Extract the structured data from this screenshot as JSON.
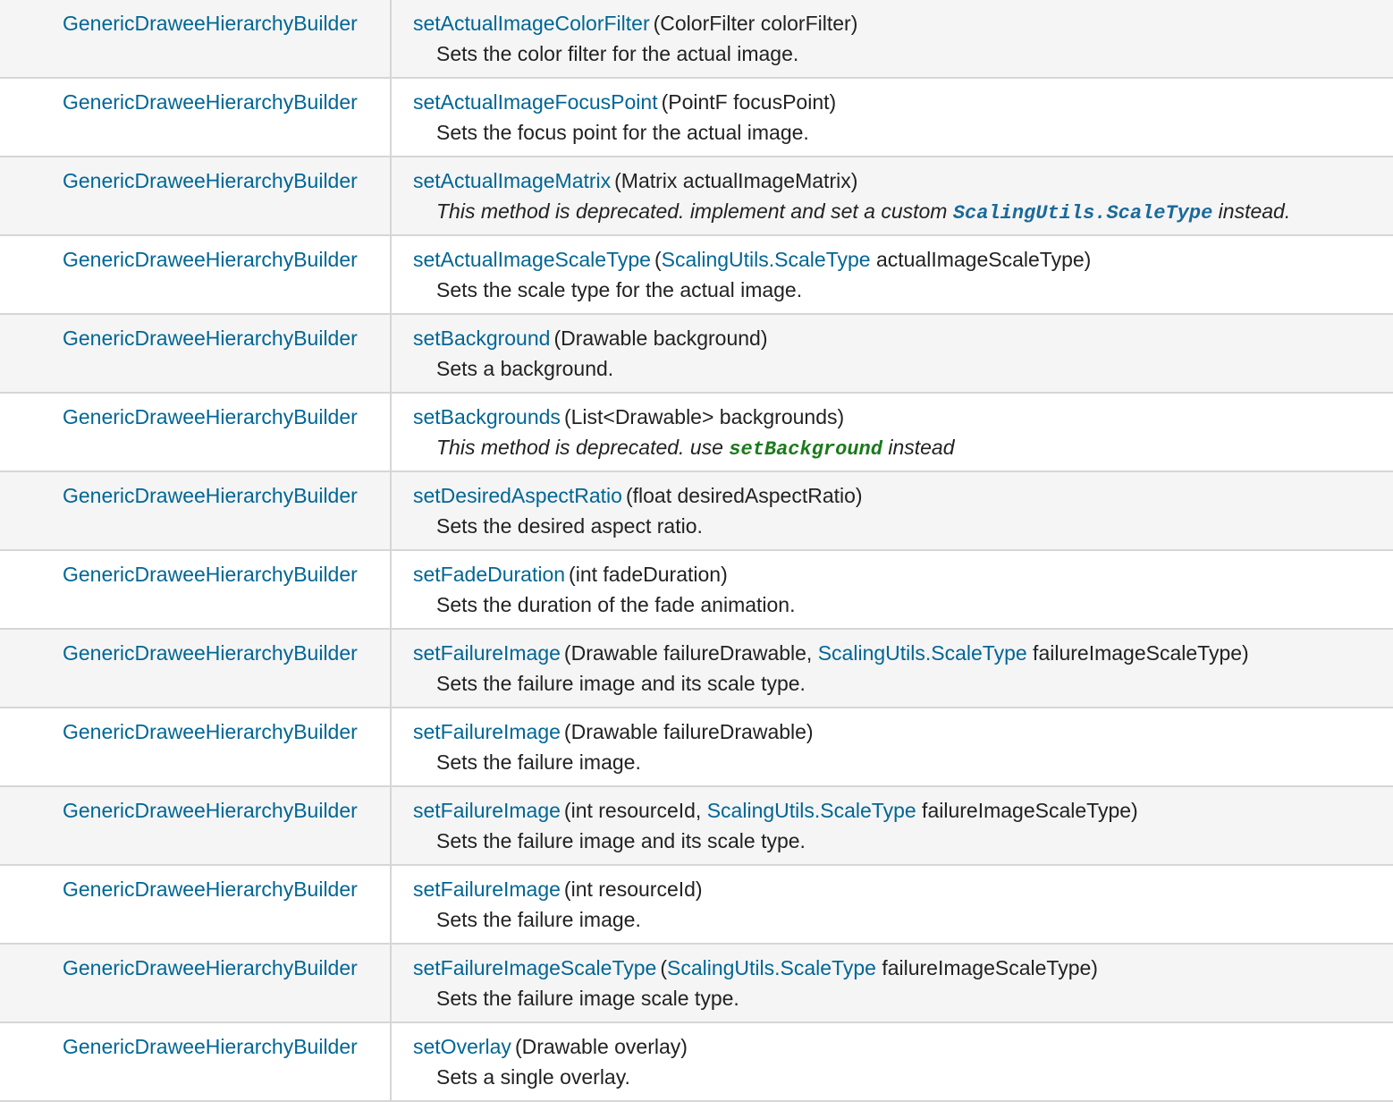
{
  "colors": {
    "link": "#006695",
    "row_shade": "#f5f5f5",
    "row_plain": "#ffffff",
    "border": "#d6d6d6",
    "code_blue": "#1a6a9a",
    "code_green": "#1b7a1b"
  },
  "rows": [
    {
      "return_type": "GenericDraweeHierarchyBuilder",
      "method": "setActualImageColorFilter",
      "params": [
        {
          "text": "(ColorFilter colorFilter)",
          "link": false
        }
      ],
      "description": "Sets the color filter for the actual image.",
      "deprecated": false
    },
    {
      "return_type": "GenericDraweeHierarchyBuilder",
      "method": "setActualImageFocusPoint",
      "params": [
        {
          "text": "(PointF focusPoint)",
          "link": false
        }
      ],
      "description": "Sets the focus point for the actual image.",
      "deprecated": false
    },
    {
      "return_type": "GenericDraweeHierarchyBuilder",
      "method": "setActualImageMatrix",
      "params": [
        {
          "text": "(Matrix actualImageMatrix)",
          "link": false
        }
      ],
      "description_parts": [
        {
          "text": "This method is deprecated. implement and set a custom ",
          "kind": "plain"
        },
        {
          "text": "ScalingUtils.ScaleType",
          "kind": "code-blue"
        },
        {
          "text": " instead.",
          "kind": "plain"
        }
      ],
      "deprecated": true
    },
    {
      "return_type": "GenericDraweeHierarchyBuilder",
      "method": "setActualImageScaleType",
      "params": [
        {
          "text": "(",
          "link": false
        },
        {
          "text": "ScalingUtils.ScaleType",
          "link": true
        },
        {
          "text": " actualImageScaleType)",
          "link": false
        }
      ],
      "description": "Sets the scale type for the actual image.",
      "deprecated": false
    },
    {
      "return_type": "GenericDraweeHierarchyBuilder",
      "method": "setBackground",
      "params": [
        {
          "text": "(Drawable background)",
          "link": false
        }
      ],
      "description": "Sets a background.",
      "deprecated": false
    },
    {
      "return_type": "GenericDraweeHierarchyBuilder",
      "method": "setBackgrounds",
      "params": [
        {
          "text": "(List<Drawable> backgrounds)",
          "link": false
        }
      ],
      "description_parts": [
        {
          "text": "This method is deprecated. use ",
          "kind": "plain"
        },
        {
          "text": "setBackground",
          "kind": "code-green"
        },
        {
          "text": " instead",
          "kind": "plain"
        }
      ],
      "deprecated": true
    },
    {
      "return_type": "GenericDraweeHierarchyBuilder",
      "method": "setDesiredAspectRatio",
      "params": [
        {
          "text": "(float desiredAspectRatio)",
          "link": false
        }
      ],
      "description": "Sets the desired aspect ratio.",
      "deprecated": false
    },
    {
      "return_type": "GenericDraweeHierarchyBuilder",
      "method": "setFadeDuration",
      "params": [
        {
          "text": "(int fadeDuration)",
          "link": false
        }
      ],
      "description": "Sets the duration of the fade animation.",
      "deprecated": false
    },
    {
      "return_type": "GenericDraweeHierarchyBuilder",
      "method": "setFailureImage",
      "params": [
        {
          "text": "(Drawable failureDrawable, ",
          "link": false
        },
        {
          "text": "ScalingUtils.ScaleType",
          "link": true
        },
        {
          "text": " failureImageScaleType)",
          "link": false
        }
      ],
      "description": "Sets the failure image and its scale type.",
      "deprecated": false
    },
    {
      "return_type": "GenericDraweeHierarchyBuilder",
      "method": "setFailureImage",
      "params": [
        {
          "text": "(Drawable failureDrawable)",
          "link": false
        }
      ],
      "description": "Sets the failure image.",
      "deprecated": false
    },
    {
      "return_type": "GenericDraweeHierarchyBuilder",
      "method": "setFailureImage",
      "params": [
        {
          "text": "(int resourceId, ",
          "link": false
        },
        {
          "text": "ScalingUtils.ScaleType",
          "link": true
        },
        {
          "text": " failureImageScaleType)",
          "link": false
        }
      ],
      "description": "Sets the failure image and its scale type.",
      "deprecated": false
    },
    {
      "return_type": "GenericDraweeHierarchyBuilder",
      "method": "setFailureImage",
      "params": [
        {
          "text": "(int resourceId)",
          "link": false
        }
      ],
      "description": "Sets the failure image.",
      "deprecated": false
    },
    {
      "return_type": "GenericDraweeHierarchyBuilder",
      "method": "setFailureImageScaleType",
      "params": [
        {
          "text": "(",
          "link": false
        },
        {
          "text": "ScalingUtils.ScaleType",
          "link": true
        },
        {
          "text": " failureImageScaleType)",
          "link": false
        }
      ],
      "description": "Sets the failure image scale type.",
      "deprecated": false
    },
    {
      "return_type": "GenericDraweeHierarchyBuilder",
      "method": "setOverlay",
      "params": [
        {
          "text": "(Drawable overlay)",
          "link": false
        }
      ],
      "description": "Sets a single overlay.",
      "deprecated": false
    }
  ]
}
